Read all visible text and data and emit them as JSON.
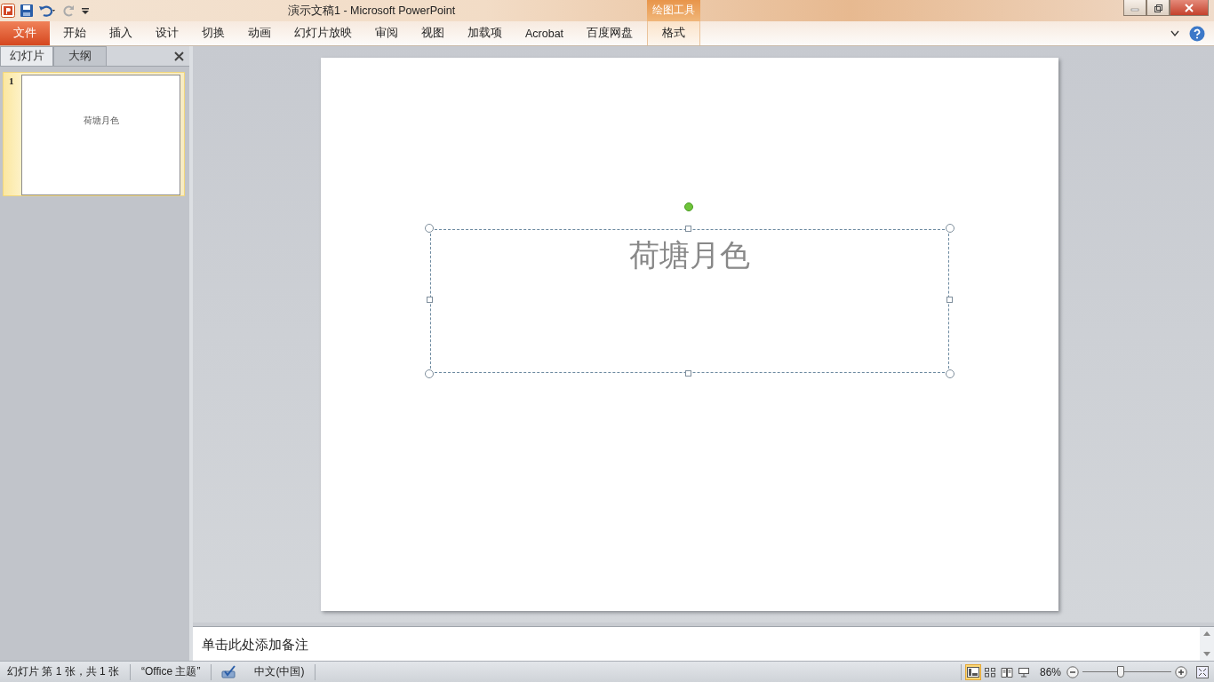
{
  "window": {
    "title": "演示文稿1 - Microsoft PowerPoint"
  },
  "contextual_group": "绘图工具",
  "ribbon_tabs": [
    {
      "label": "文件",
      "kind": "file"
    },
    {
      "label": "开始",
      "kind": "normal"
    },
    {
      "label": "插入",
      "kind": "normal"
    },
    {
      "label": "设计",
      "kind": "normal"
    },
    {
      "label": "切换",
      "kind": "normal"
    },
    {
      "label": "动画",
      "kind": "normal"
    },
    {
      "label": "幻灯片放映",
      "kind": "normal"
    },
    {
      "label": "审阅",
      "kind": "normal"
    },
    {
      "label": "视图",
      "kind": "normal"
    },
    {
      "label": "加载项",
      "kind": "normal"
    },
    {
      "label": "Acrobat",
      "kind": "normal"
    },
    {
      "label": "百度网盘",
      "kind": "normal"
    },
    {
      "label": "格式",
      "kind": "contextual"
    }
  ],
  "panel_tabs": [
    {
      "label": "幻灯片",
      "selected": true
    },
    {
      "label": "大纲",
      "selected": false
    }
  ],
  "thumbnails": [
    {
      "number": "1",
      "text": "荷塘月色",
      "selected": true
    }
  ],
  "slide": {
    "title": "荷塘月色"
  },
  "notes": {
    "placeholder": "单击此处添加备注"
  },
  "status_bar": {
    "slide_info": "幻灯片 第 1 张，共 1 张",
    "theme": "“Office 主题”",
    "language": "中文(中国)",
    "views": [
      {
        "kind": "normal",
        "selected": true
      },
      {
        "kind": "sorter",
        "selected": false
      },
      {
        "kind": "reading",
        "selected": false
      },
      {
        "kind": "slideshow",
        "selected": false
      }
    ],
    "zoom": "86%",
    "zoom_slider": {
      "level": 0.43
    }
  }
}
